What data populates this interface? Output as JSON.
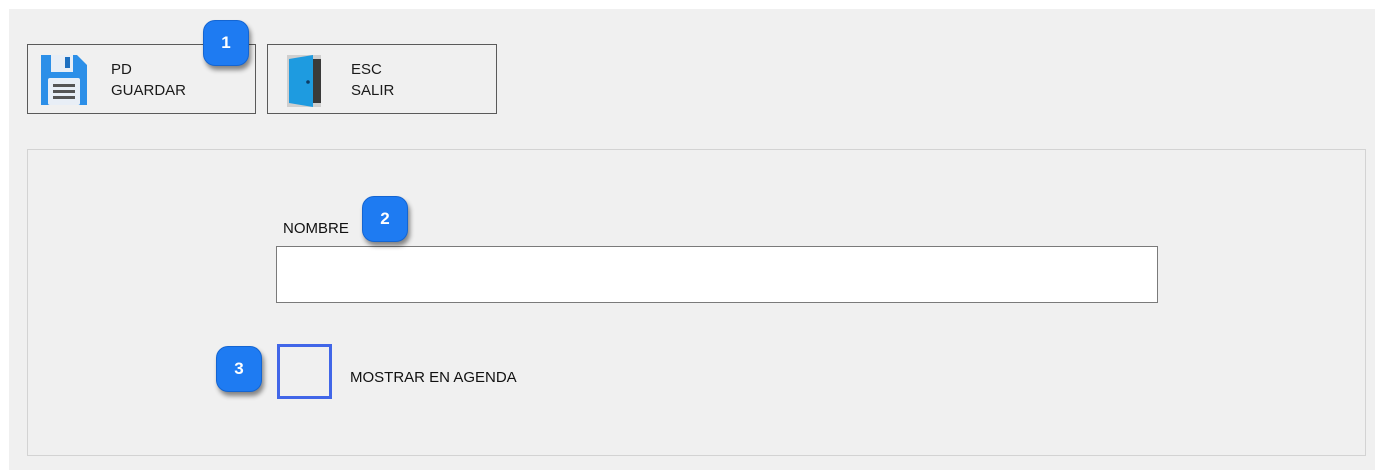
{
  "toolbar": {
    "save": {
      "shortcut": "PD",
      "label": "GUARDAR",
      "icon": "floppy-disk-icon"
    },
    "exit": {
      "shortcut": "ESC",
      "label": "SALIR",
      "icon": "exit-door-icon"
    }
  },
  "form": {
    "name_label": "NOMBRE",
    "name_value": "",
    "show_in_agenda_label": "MOSTRAR EN AGENDA",
    "show_in_agenda_checked": false
  },
  "callouts": [
    "1",
    "2",
    "3"
  ],
  "colors": {
    "background": "#f0f0f0",
    "callout": "#1e7bf2",
    "checkbox_border": "#4166e8",
    "floppy_icon": "#2c8fe8",
    "door_icon": "#1e9be0"
  }
}
